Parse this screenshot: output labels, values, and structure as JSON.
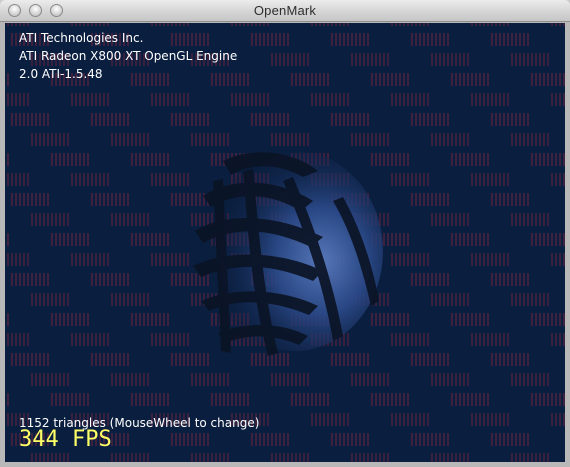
{
  "window": {
    "title": "OpenMark"
  },
  "overlay": {
    "vendor": "ATI Technologies Inc.",
    "renderer": "ATI Radeon X800 XT OpenGL Engine",
    "version": "2.0 ATI-1.5.48",
    "triangles_info": "1152 triangles (MouseWheel to change)",
    "fps": "344 FPS"
  },
  "colors": {
    "background": "#0a1f3f",
    "checker_stripe": "#5a1f3a",
    "fps_text": "#ffff66",
    "overlay_text": "#ffffff"
  },
  "icons": {
    "close": "close-button",
    "minimize": "minimize-button",
    "zoom": "zoom-button"
  }
}
